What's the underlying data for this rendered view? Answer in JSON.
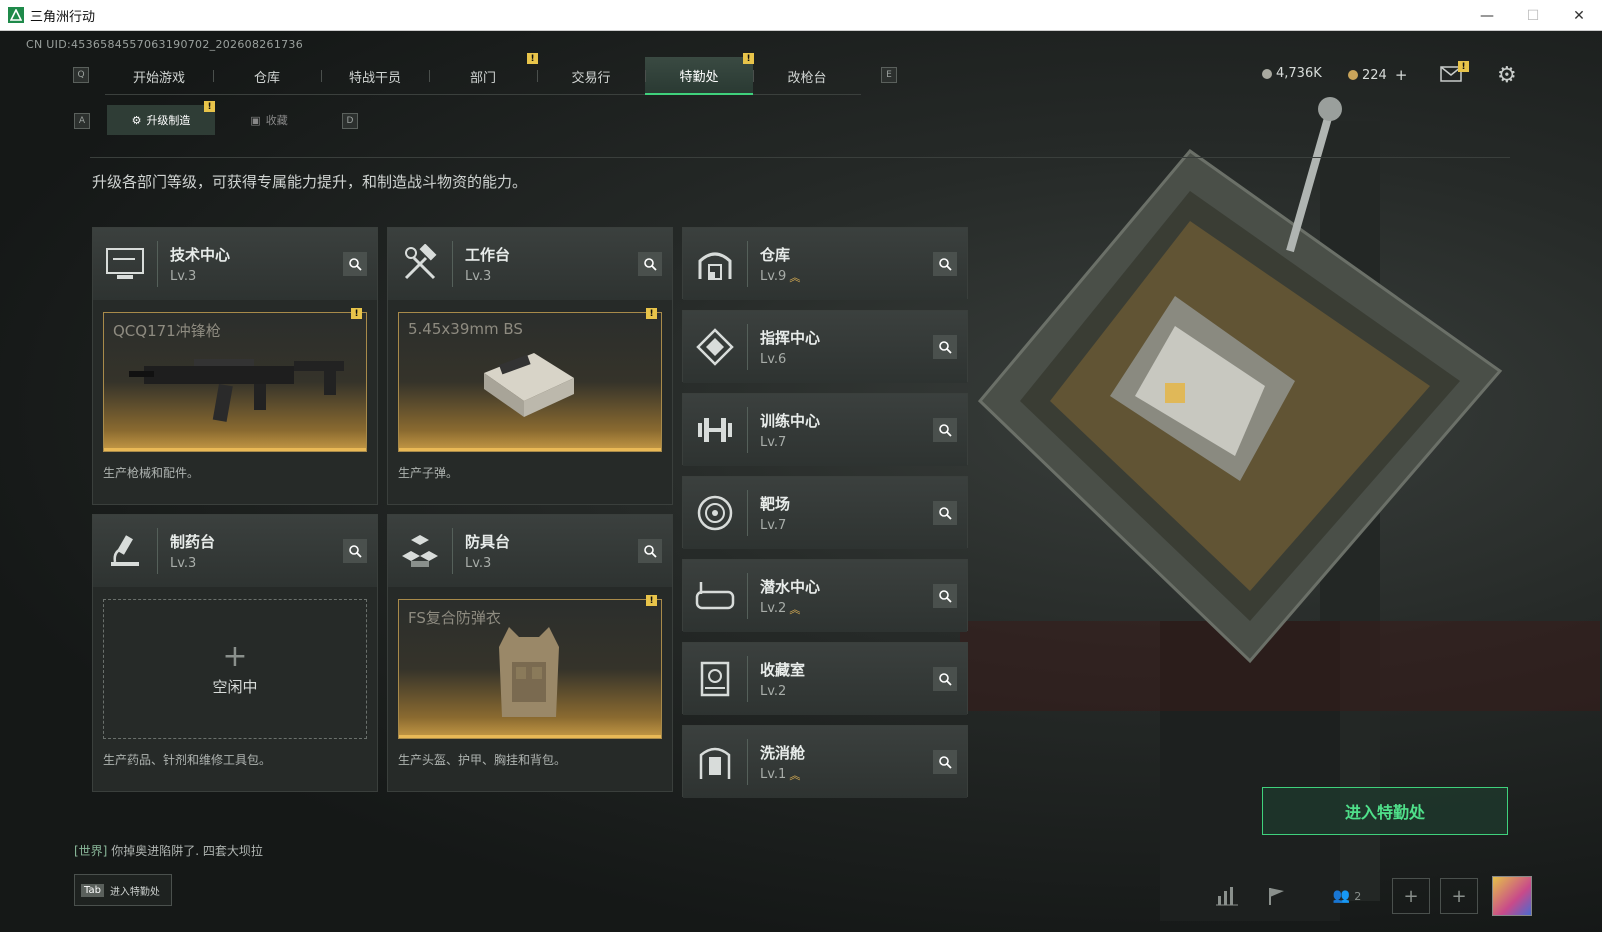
{
  "window": {
    "title": "三角洲行动",
    "minimize": "—",
    "maximize": "☐",
    "close": "✕"
  },
  "uid": "CN UID:4536584557063190702_202608261736",
  "top_tabs": [
    {
      "label": "开始游戏"
    },
    {
      "label": "仓库"
    },
    {
      "label": "特战干员"
    },
    {
      "label": "部门"
    },
    {
      "label": "交易行"
    },
    {
      "label": "特勤处"
    },
    {
      "label": "改枪台"
    }
  ],
  "keys": {
    "prev": "Q",
    "next": "E",
    "sub_prev": "A",
    "sub_next": "D"
  },
  "currency": {
    "silver": "4,736K",
    "gold": "224",
    "gold_add": "+"
  },
  "sub_tabs": [
    {
      "label": "升级制造"
    },
    {
      "label": "收藏"
    }
  ],
  "intro": "升级各部门等级，可获得专属能力提升，和制造战斗物资的能力。",
  "left_cards": [
    {
      "name": "技术中心",
      "level": "Lv.3",
      "product": "QCQ171冲锋枪",
      "desc": "生产枪械和配件。"
    },
    {
      "name": "工作台",
      "level": "Lv.3",
      "product": "5.45x39mm BS",
      "desc": "生产子弹。"
    },
    {
      "name": "制药台",
      "level": "Lv.3",
      "idle": "空闲中",
      "desc": "生产药品、针剂和维修工具包。"
    },
    {
      "name": "防具台",
      "level": "Lv.3",
      "product": "FS复合防弹衣",
      "desc": "生产头盔、护甲、胸挂和背包。"
    }
  ],
  "right_cards": [
    {
      "name": "仓库",
      "level": "Lv.9"
    },
    {
      "name": "指挥中心",
      "level": "Lv.6"
    },
    {
      "name": "训练中心",
      "level": "Lv.7"
    },
    {
      "name": "靶场",
      "level": "Lv.7"
    },
    {
      "name": "潜水中心",
      "level": "Lv.2"
    },
    {
      "name": "收藏室",
      "level": "Lv.2"
    },
    {
      "name": "洗消舱",
      "level": "Lv.1"
    }
  ],
  "enter_button": "进入特勤处",
  "chat": {
    "channel": "[世界]",
    "text": "你掉奥进陷阱了. 四套大坝拉"
  },
  "tab_hint": {
    "key": "Tab",
    "label": "进入特勤处"
  },
  "squad_count": "2",
  "colors": {
    "accent": "#3fd17c",
    "gold": "#e9b956",
    "alert": "#e8c44a"
  }
}
